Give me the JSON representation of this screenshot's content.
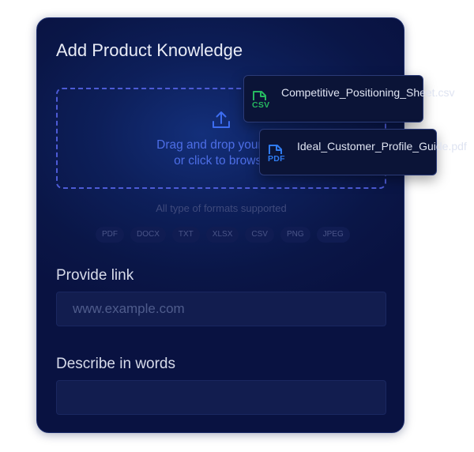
{
  "panel": {
    "title": "Add Product Knowledge"
  },
  "dropzone": {
    "line1": "Drag and drop your mat",
    "line2": "or click to browse",
    "icon": "upload-icon",
    "accent": "#4d6ee6"
  },
  "formats": {
    "note": "All type of formats supported",
    "items": [
      "PDF",
      "DOCX",
      "TXT",
      "XLSX",
      "CSV",
      "PNG",
      "JPEG"
    ]
  },
  "link_field": {
    "label": "Provide link",
    "placeholder": "www.example.com"
  },
  "describe_field": {
    "label": "Describe in words",
    "placeholder": ""
  },
  "files": [
    {
      "ext": "CSV",
      "name": "Competitive_Positioning_Sheet.csv",
      "color": "#26b860",
      "icon": "csv-file-icon"
    },
    {
      "ext": "PDF",
      "name": "Ideal_Customer_Profile_Guide.pdf",
      "color": "#2f7bf0",
      "icon": "pdf-file-icon"
    }
  ]
}
